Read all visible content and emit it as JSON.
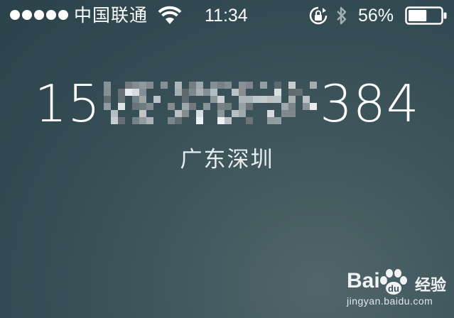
{
  "status_bar": {
    "signal_bars": 5,
    "carrier": "中国联通",
    "time": "11:34",
    "battery_percent": "56%",
    "battery_level": 0.56,
    "icons": [
      "wifi-icon",
      "rotation-lock-icon",
      "bluetooth-icon",
      "battery-icon"
    ]
  },
  "caller": {
    "number_prefix": "15",
    "number_suffix": "384",
    "location": "广东深圳"
  },
  "watermark": {
    "brand": "Bai",
    "brand_suffix": "经验",
    "url": "jingyan.baidu.com"
  }
}
